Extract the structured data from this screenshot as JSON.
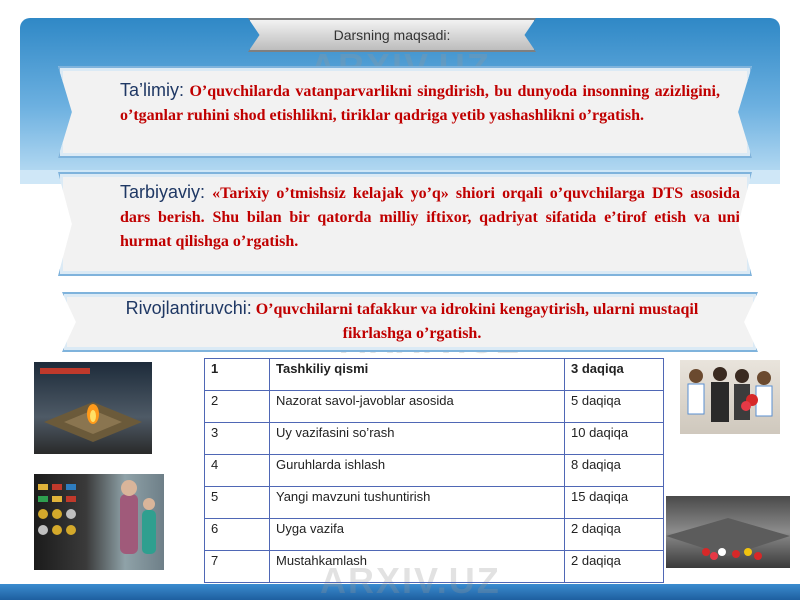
{
  "header": {
    "title": "Darsning  maqsadi:"
  },
  "objectives": [
    {
      "label": "Ta’limiy:",
      "text": " O’quvchilarda  vatanparvarlikni  singdirish, bu  dunyoda  insonning  azizligini, o’tganlar  ruhini shod  etishlikni, tiriklar  qadriga  yetib  yashashlikni  o’rgatish."
    },
    {
      "label": "Tarbiyaviy:",
      "text": "  «Tarixiy  o’tmishsiz  kelajak  yo’q» shiori  orqali o’quvchilarga DTS asosida dars berish. Shu bilan bir qatorda milliy iftixor, qadriyat sifatida e’tirof etish va uni hurmat qilishga o’rgatish."
    },
    {
      "label": "Rivojlantiruvchi:",
      "text": "  O’quvchilarni  tafakkur  va  idrokini kengaytirish, ularni  mustaqil  fikrlashga  o’rgatish."
    }
  ],
  "watermark": "ARXIV.UZ",
  "plan_table": {
    "rows": [
      {
        "num": "1",
        "stage": "Tashkiliy  qismi",
        "time": "3 daqiqa"
      },
      {
        "num": "2",
        "stage": "Nazorat  savol-javoblar  asosida",
        "time": "5    daqiqa"
      },
      {
        "num": "3",
        "stage": "Uy  vazifasini  so’rash",
        "time": "10   daqiqa"
      },
      {
        "num": "4",
        "stage": "Guruhlarda  ishlash",
        "time": "8    daqiqa"
      },
      {
        "num": "5",
        "stage": "Yangi  mavzuni  tushuntirish",
        "time": "15   daqiqa"
      },
      {
        "num": "6",
        "stage": "Uyga  vazifa",
        "time": "2    daqiqa"
      },
      {
        "num": "7",
        "stage": "Mustahkamlash",
        "time": "2    daqiqa"
      }
    ]
  },
  "photos": [
    {
      "name": "eternal-flame-memorial"
    },
    {
      "name": "veteran-medals"
    },
    {
      "name": "students-with-veteran"
    },
    {
      "name": "memorial-flowers"
    }
  ],
  "colors": {
    "accent": "#2f88c6",
    "objective_text": "#c00000",
    "label": "#1f3864",
    "table_border": "#4f67b5"
  }
}
